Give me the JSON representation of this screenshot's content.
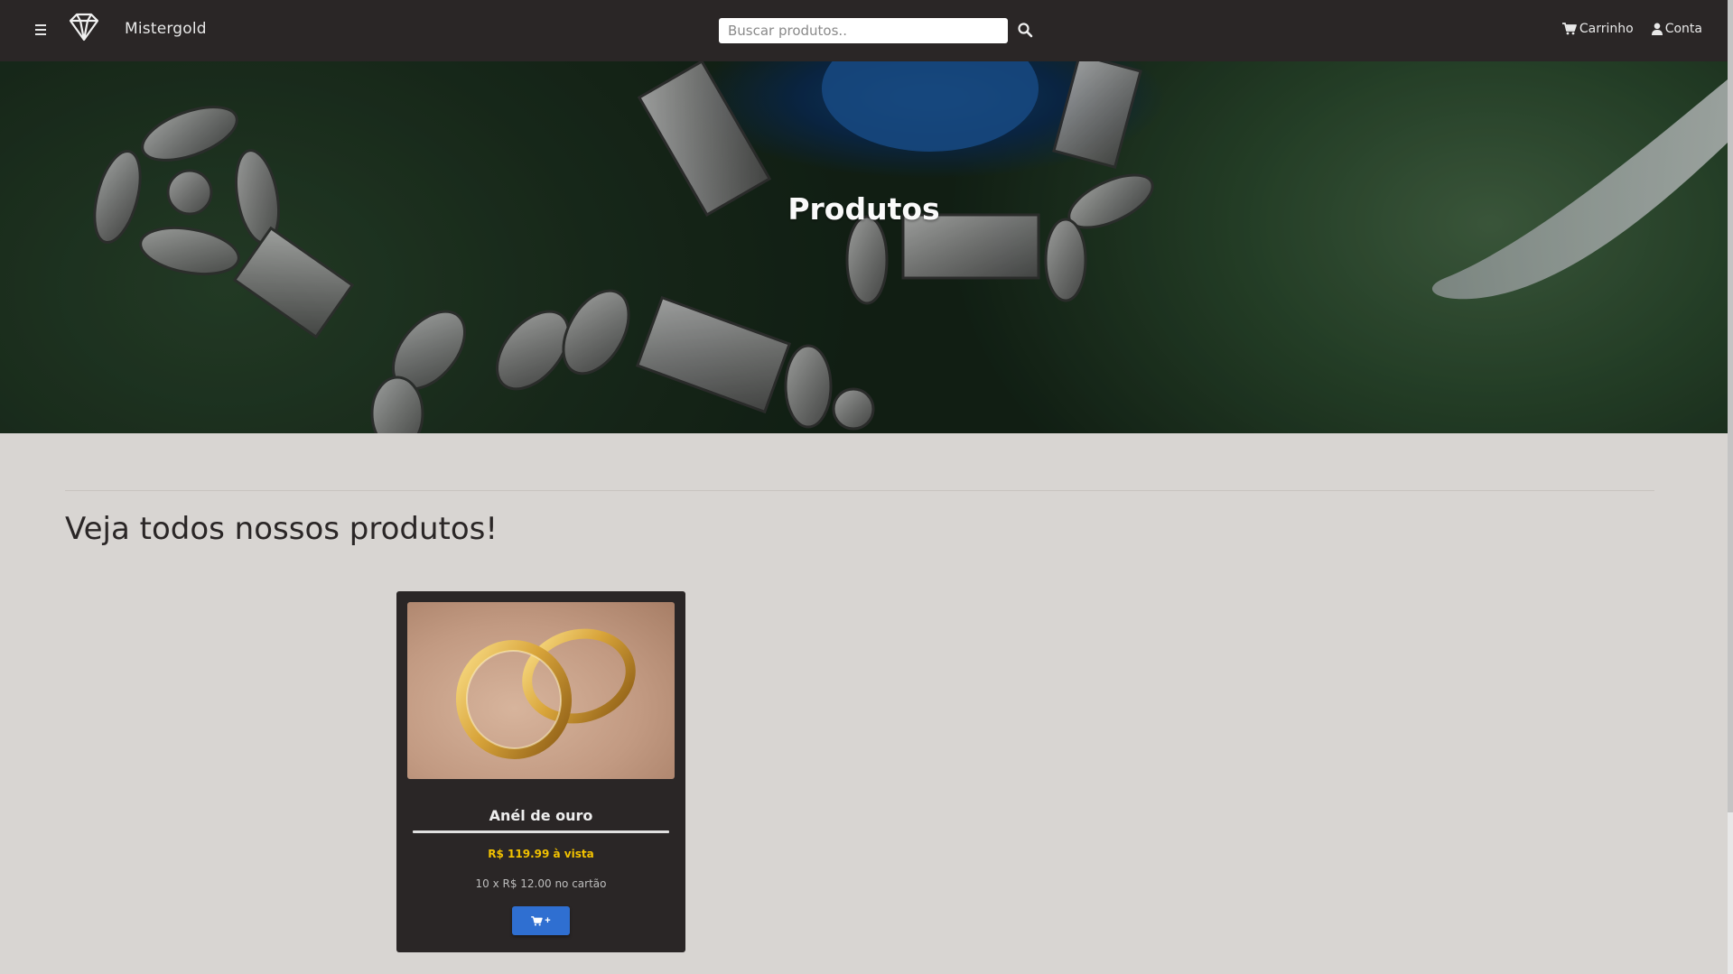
{
  "navbar": {
    "brand": "Mistergold",
    "search_placeholder": "Buscar produtos..",
    "cart_label": "Carrinho",
    "account_label": "Conta",
    "icons": {
      "menu": "hamburger-icon",
      "logo": "diamond-logo-icon",
      "search": "search-icon",
      "cart": "cart-icon",
      "account": "user-icon"
    }
  },
  "hero": {
    "title": "Produtos"
  },
  "main": {
    "section_title": "Veja todos nossos produtos!",
    "products": [
      {
        "name": "Anél de ouro",
        "price_text": "R$ 119.99 à vista",
        "installments_text": "10 x R$ 12.00 no cartão",
        "button_label": "+",
        "button_icon": "cart-icon"
      }
    ]
  },
  "colors": {
    "navbar_bg": "#2a2626",
    "page_bg": "#d8d5d2",
    "price_color": "#f2c200",
    "button_color": "#2f6fd1"
  }
}
